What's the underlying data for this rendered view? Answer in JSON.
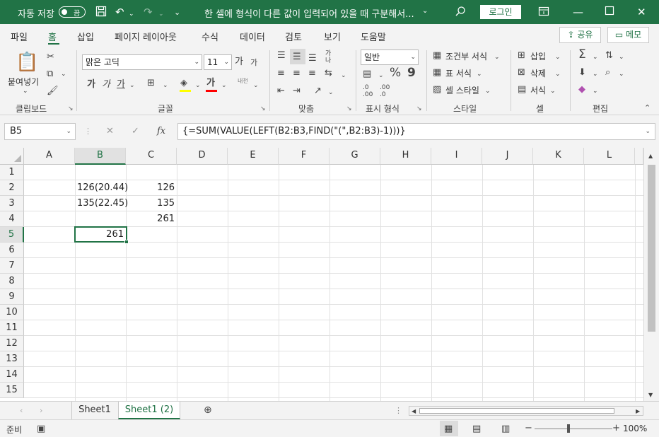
{
  "titlebar": {
    "autosave_label": "자동 저장",
    "autosave_state": "끔",
    "title": "한 셀에 형식이 다른 값이 입력되어 있을 때 구분해서...",
    "login": "로그인",
    "title_dropdown": "⌄",
    "qat_more": "⌄"
  },
  "tabs": [
    "파일",
    "홈",
    "삽입",
    "페이지 레이아웃",
    "수식",
    "데이터",
    "검토",
    "보기",
    "도움말"
  ],
  "share_label": "공유",
  "memo_label": "메모",
  "ribbon": {
    "clipboard": {
      "paste": "붙여넣기",
      "group": "클립보드"
    },
    "font": {
      "name": "맑은 고딕",
      "size": "11",
      "bold": "가",
      "italic": "가",
      "underline": "가",
      "grow": "가",
      "shrink": "가",
      "font_color": "가",
      "phonetic": "내천",
      "group": "글꼴"
    },
    "alignment": {
      "wrap": "가나",
      "group": "맞춤"
    },
    "number": {
      "format": "일반",
      "percent": "%",
      "comma": "9",
      "inc_dec": ".0\n.00",
      "dec_dec": ".00\n.0",
      "group": "표시 형식"
    },
    "styles": {
      "conditional": "조건부 서식",
      "table": "표 서식",
      "cell": "셀 스타일",
      "group": "스타일"
    },
    "cells": {
      "insert": "삽입",
      "delete": "삭제",
      "format": "서식",
      "group": "셀"
    },
    "editing": {
      "group": "편집"
    }
  },
  "formula_bar": {
    "name_box": "B5",
    "formula": "{=SUM(VALUE(LEFT(B2:B3,FIND(\"(\",B2:B3)-1)))}",
    "fx": "fx"
  },
  "columns": [
    "A",
    "B",
    "C",
    "D",
    "E",
    "F",
    "G",
    "H",
    "I",
    "J",
    "K",
    "L"
  ],
  "rows": [
    "1",
    "2",
    "3",
    "4",
    "5",
    "6",
    "7",
    "8",
    "9",
    "10",
    "11",
    "12",
    "13",
    "14",
    "15"
  ],
  "cells": {
    "B2": "126(20.44)",
    "C2": "126",
    "B3": "135(22.45)",
    "C3": "135",
    "C4": "261",
    "B5": "261"
  },
  "sheets": [
    "Sheet1",
    "Sheet1 (2)"
  ],
  "active_sheet": "Sheet1 (2)",
  "status": {
    "ready": "준비",
    "zoom": "100%"
  },
  "accent_color": "#217346"
}
